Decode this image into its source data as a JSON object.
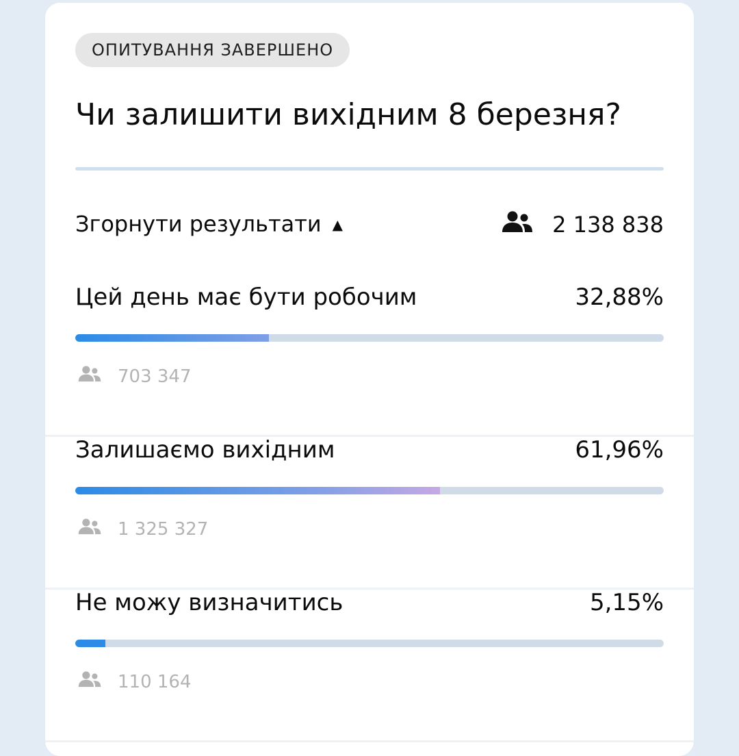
{
  "poll": {
    "status_badge": "ОПИТУВАННЯ ЗАВЕРШЕНО",
    "question": "Чи залишити вихідним 8 березня?",
    "collapse_label": "Згорнути результати",
    "total_votes": "2 138 838",
    "options": [
      {
        "label": "Цей день має бути робочим",
        "percent_text": "32,88%",
        "percent": 32.88,
        "votes": "703 347"
      },
      {
        "label": "Залишаємо вихідним",
        "percent_text": "61,96%",
        "percent": 61.96,
        "votes": "1 325 327"
      },
      {
        "label": "Не можу визначитись",
        "percent_text": "5,15%",
        "percent": 5.15,
        "votes": "110 164"
      }
    ]
  },
  "colors": {
    "page_bg": "#e3ecf4",
    "card_bg": "#ffffff",
    "bar_track": "#cfdce8",
    "bar_start": "#2b8be6",
    "bar_mid": "#7f9fe6",
    "bar_end": "#c6a8e4",
    "muted_text": "#b3b3b3"
  },
  "icons": {
    "total_votes": "people-icon",
    "option_votes": "people-icon",
    "collapse": "caret-up-icon"
  }
}
